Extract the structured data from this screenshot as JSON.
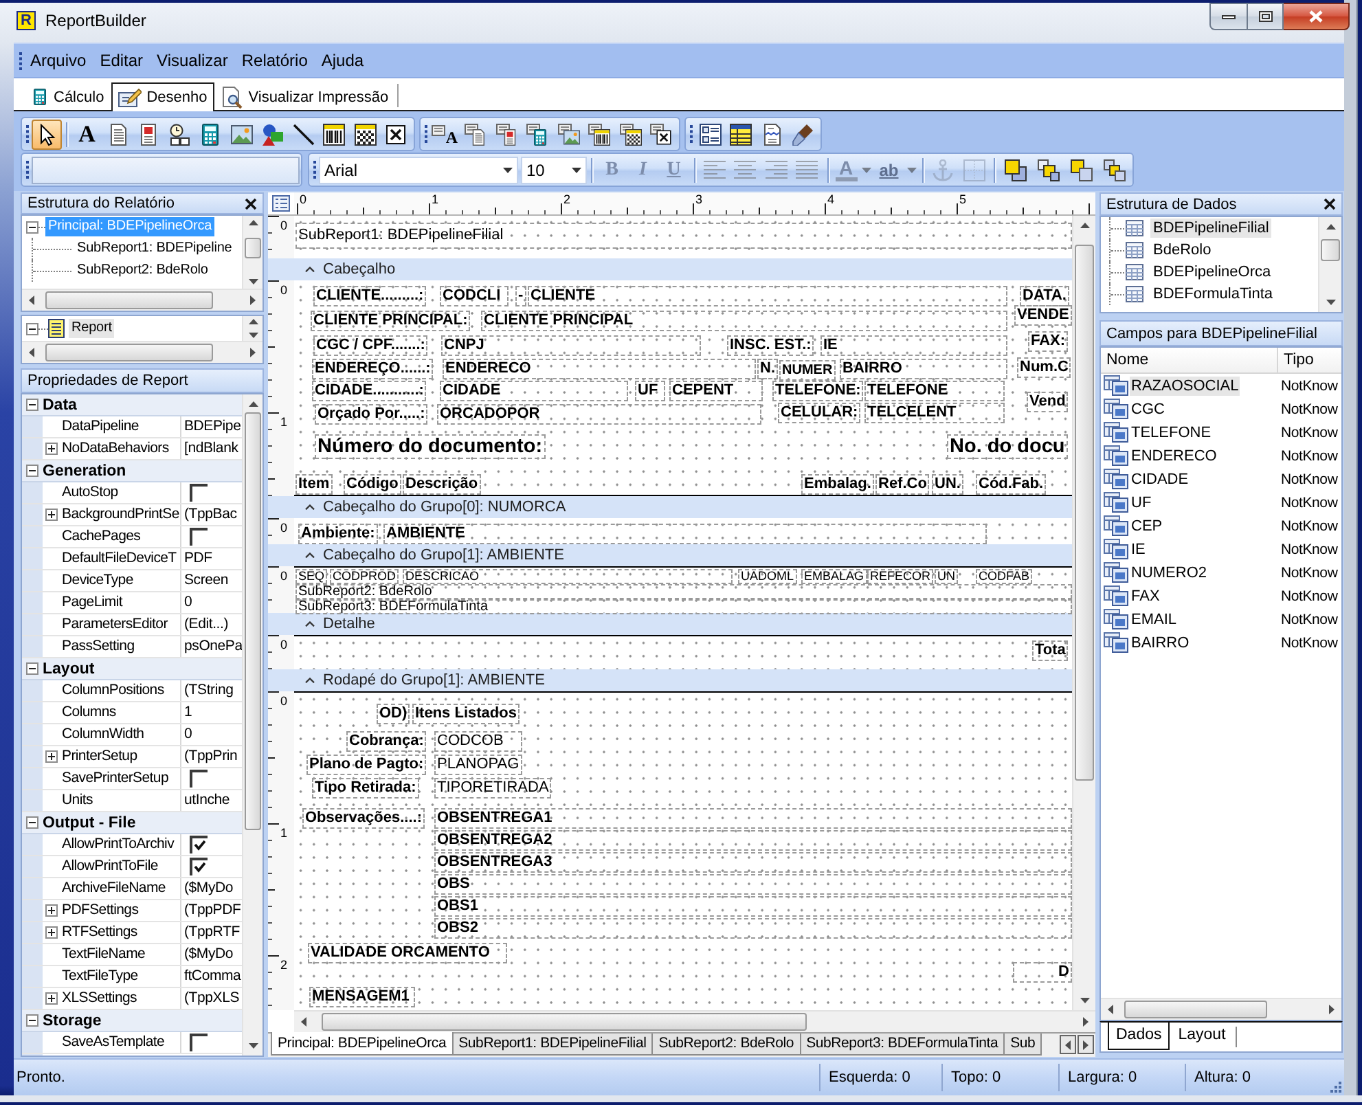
{
  "window": {
    "title": "ReportBuilder",
    "logo_letter": "R"
  },
  "menu": [
    "Arquivo",
    "Editar",
    "Visualizar",
    "Relatório",
    "Ajuda"
  ],
  "view_tabs": [
    {
      "kind": "calculator",
      "label": "Cálculo",
      "selected": false
    },
    {
      "kind": "design",
      "label": "Desenho",
      "selected": true
    },
    {
      "kind": "preview",
      "label": "Visualizar Impressão",
      "selected": false
    }
  ],
  "toolbars": {
    "components": [
      {
        "kind": "pointer",
        "selected": true
      },
      {
        "kind": "label",
        "glyph": "A",
        "selected": false
      },
      {
        "kind": "memo",
        "selected": false
      },
      {
        "kind": "richtext",
        "selected": false
      },
      {
        "kind": "sysvar",
        "selected": false
      },
      {
        "kind": "calc",
        "selected": false
      },
      {
        "kind": "image",
        "selected": false
      },
      {
        "kind": "shape",
        "selected": false
      },
      {
        "kind": "line",
        "selected": false
      },
      {
        "kind": "barcode",
        "selected": false
      },
      {
        "kind": "matrix",
        "selected": false
      },
      {
        "kind": "checkbox",
        "selected": false
      }
    ],
    "data_components": [
      {
        "kind": "dbtext",
        "glyph": "A",
        "selected": false
      },
      {
        "kind": "dbmemo",
        "selected": false
      },
      {
        "kind": "dbrichtext",
        "selected": false
      },
      {
        "kind": "dbcalc",
        "selected": false
      },
      {
        "kind": "dbimage",
        "selected": false
      },
      {
        "kind": "dbbarcode",
        "selected": false
      },
      {
        "kind": "dbmatrix",
        "selected": false
      },
      {
        "kind": "dbcheckbox",
        "selected": false
      }
    ],
    "advanced": [
      {
        "kind": "region",
        "selected": false
      },
      {
        "kind": "subreport",
        "selected": false
      },
      {
        "kind": "pagebreak",
        "selected": false
      },
      {
        "kind": "brush",
        "selected": false
      }
    ],
    "format": {
      "font": "Arial",
      "size": "10",
      "buttons": [
        {
          "kind": "bold",
          "glyph": "B",
          "disabled": true
        },
        {
          "kind": "italic",
          "glyph": "I",
          "disabled": true
        },
        {
          "kind": "underline",
          "glyph": "U",
          "disabled": true
        },
        {
          "kind": "align_left",
          "disabled": true
        },
        {
          "kind": "align_center",
          "disabled": true
        },
        {
          "kind": "align_right",
          "disabled": true
        },
        {
          "kind": "justify",
          "disabled": true
        },
        {
          "kind": "font_color",
          "glyph": "A",
          "disabled": true
        },
        {
          "kind": "highlight",
          "glyph": "ab",
          "disabled": true
        },
        {
          "kind": "anchor",
          "disabled": true
        },
        {
          "kind": "border",
          "disabled": true
        },
        {
          "kind": "bring_front",
          "disabled": false
        },
        {
          "kind": "send_back",
          "disabled": false
        },
        {
          "kind": "bring_forward",
          "disabled": false
        },
        {
          "kind": "send_backward",
          "disabled": false
        }
      ]
    }
  },
  "report_panel": {
    "title": "Estrutura do Relatório",
    "tree": [
      {
        "label": "Principal: BDEPipelineOrca",
        "selected": true,
        "expanded": true,
        "children": [
          {
            "label": "SubReport1: BDEPipeline",
            "selected": false
          },
          {
            "label": "SubReport2: BdeRolo",
            "selected": false
          }
        ]
      }
    ],
    "components": [
      {
        "label": "Report",
        "selected": true,
        "expanded": true
      }
    ]
  },
  "properties": {
    "title": "Propriedades de Report",
    "categories": [
      {
        "name": "Data",
        "expanded": true,
        "rows": [
          {
            "kind": "text",
            "name": "DataPipeline",
            "value": "BDEPipe",
            "expandable": false
          },
          {
            "kind": "text",
            "name": "NoDataBehaviors",
            "value": "[ndBlank",
            "expandable": true
          }
        ]
      },
      {
        "name": "Generation",
        "expanded": true,
        "rows": [
          {
            "kind": "check",
            "name": "AutoStop",
            "checked": false,
            "expandable": false
          },
          {
            "kind": "text",
            "name": "BackgroundPrintSe",
            "value": "(TppBac",
            "expandable": true
          },
          {
            "kind": "check",
            "name": "CachePages",
            "checked": false,
            "expandable": false
          },
          {
            "kind": "text",
            "name": "DefaultFileDeviceT",
            "value": "PDF",
            "expandable": false
          },
          {
            "kind": "text",
            "name": "DeviceType",
            "value": "Screen",
            "expandable": false
          },
          {
            "kind": "text",
            "name": "PageLimit",
            "value": "0",
            "expandable": false
          },
          {
            "kind": "text",
            "name": "ParametersEditor",
            "value": "(Edit...)",
            "expandable": false
          },
          {
            "kind": "text",
            "name": "PassSetting",
            "value": "psOnePa",
            "expandable": false
          }
        ]
      },
      {
        "name": "Layout",
        "expanded": true,
        "rows": [
          {
            "kind": "text",
            "name": "ColumnPositions",
            "value": "(TString",
            "expandable": false
          },
          {
            "kind": "text",
            "name": "Columns",
            "value": "1",
            "expandable": false
          },
          {
            "kind": "text",
            "name": "ColumnWidth",
            "value": "0",
            "expandable": false
          },
          {
            "kind": "text",
            "name": "PrinterSetup",
            "value": "(TppPrin",
            "expandable": true
          },
          {
            "kind": "check",
            "name": "SavePrinterSetup",
            "checked": false,
            "expandable": false
          },
          {
            "kind": "text",
            "name": "Units",
            "value": "utInche",
            "expandable": false
          }
        ]
      },
      {
        "name": "Output - File",
        "expanded": true,
        "rows": [
          {
            "kind": "check",
            "name": "AllowPrintToArchiv",
            "checked": true,
            "expandable": false
          },
          {
            "kind": "check",
            "name": "AllowPrintToFile",
            "checked": true,
            "expandable": false
          },
          {
            "kind": "text",
            "name": "ArchiveFileName",
            "value": "($MyDo",
            "expandable": false
          },
          {
            "kind": "text",
            "name": "PDFSettings",
            "value": "(TppPDF",
            "expandable": true
          },
          {
            "kind": "text",
            "name": "RTFSettings",
            "value": "(TppRTF",
            "expandable": true
          },
          {
            "kind": "text",
            "name": "TextFileName",
            "value": "($MyDo",
            "expandable": false
          },
          {
            "kind": "text",
            "name": "TextFileType",
            "value": "ftComma",
            "expandable": false
          },
          {
            "kind": "text",
            "name": "XLSSettings",
            "value": "(TppXLS",
            "expandable": true
          }
        ]
      },
      {
        "name": "Storage",
        "expanded": true,
        "rows": [
          {
            "kind": "check",
            "name": "SaveAsTemplate",
            "checked": false,
            "expandable": false
          }
        ]
      }
    ]
  },
  "designer": {
    "ruler": [
      "0",
      "1",
      "2",
      "3",
      "4",
      "5"
    ],
    "bands": [
      {
        "ruler": [
          "0"
        ],
        "items": [
          "SubReport1: BDEPipelineFilial"
        ],
        "caption": "Cabeçalho"
      },
      {
        "ruler": [
          "0",
          "1"
        ],
        "items": [
          "CLIENTE.........:",
          "CODCLI",
          "-",
          "CLIENTE",
          "DATA.",
          "CLIENTE PRINCIPAL:",
          "CLIENTE PRINCIPAL",
          "VENDE",
          "CGC / CPF.......:",
          "CNPJ",
          "INSC. EST.:",
          "IE",
          "FAX:",
          "ENDEREÇO......:",
          "ENDERECO",
          "N.",
          "NUMER",
          "BAIRRO",
          "Num.C",
          "CIDADE...........:",
          "CIDADE",
          "UF",
          "CEPENT",
          "TELEFONE:",
          "TELEFONE",
          "Vend",
          "Orçado Por.....:",
          "ORCADOPOR",
          "CELULAR:",
          "TELCELENT",
          "Número do documento:",
          "No. do docu",
          "Item",
          "Código",
          "Descrição",
          "Embalag.",
          "Ref.Co",
          "UN.",
          "Cód.Fab."
        ],
        "caption": "Cabeçalho do Grupo[0]: NUMORCA"
      },
      {
        "ruler": [
          "0"
        ],
        "items": [
          "Ambiente:",
          "AMBIENTE"
        ],
        "caption": "Cabeçalho do Grupo[1]: AMBIENTE"
      },
      {
        "ruler": [
          "0"
        ],
        "items": [
          "SEQ",
          "CODPROD",
          "DESCRICAO",
          "UADOML",
          "EMBALAG",
          "REFECOR",
          "UN",
          "CODFAB",
          "SubReport2: BdeRolo",
          "SubReport3: BDEFormulaTinta"
        ],
        "caption": "Detalhe"
      },
      {
        "ruler": [
          "0"
        ],
        "items": [
          "Tota"
        ],
        "caption": "Rodapé do Grupo[1]: AMBIENTE"
      },
      {
        "ruler": [
          "0",
          "1",
          "2"
        ],
        "items": [
          "OD)",
          "Itens Listados",
          "Cobrança:",
          "CODCOB",
          "Plano de Pagto:",
          "PLANOPAG",
          "Tipo Retirada:",
          "TIPORETIRADA",
          "Observações....:",
          "OBSENTREGA1",
          "OBSENTREGA2",
          "OBSENTREGA3",
          "OBS",
          "OBS1",
          "OBS2",
          "VALIDADE ORCAMENTO",
          "D",
          "MENSAGEM1"
        ]
      }
    ],
    "tabs": [
      {
        "label": "Principal: BDEPipelineOrca",
        "selected": true
      },
      {
        "label": "SubReport1: BDEPipelineFilial",
        "selected": false
      },
      {
        "label": "SubReport2: BdeRolo",
        "selected": false
      },
      {
        "label": "SubReport3: BDEFormulaTinta",
        "selected": false
      },
      {
        "label": "Sub",
        "selected": false
      }
    ]
  },
  "data_panel": {
    "title": "Estrutura de Dados",
    "pipelines": [
      {
        "label": "BDEPipelineFilial",
        "selected": true
      },
      {
        "label": "BdeRolo",
        "selected": false
      },
      {
        "label": "BDEPipelineOrca",
        "selected": false
      },
      {
        "label": "BDEFormulaTinta",
        "selected": false
      }
    ],
    "fields_title": "Campos para BDEPipelineFilial",
    "columns": [
      "Nome",
      "Tipo"
    ],
    "fields": [
      {
        "name": "RAZAOSOCIAL",
        "type": "NotKnow",
        "selected": true
      },
      {
        "name": "CGC",
        "type": "NotKnow",
        "selected": false
      },
      {
        "name": "TELEFONE",
        "type": "NotKnow",
        "selected": false
      },
      {
        "name": "ENDERECO",
        "type": "NotKnow",
        "selected": false
      },
      {
        "name": "CIDADE",
        "type": "NotKnow",
        "selected": false
      },
      {
        "name": "UF",
        "type": "NotKnow",
        "selected": false
      },
      {
        "name": "CEP",
        "type": "NotKnow",
        "selected": false
      },
      {
        "name": "IE",
        "type": "NotKnow",
        "selected": false
      },
      {
        "name": "NUMERO2",
        "type": "NotKnow",
        "selected": false
      },
      {
        "name": "FAX",
        "type": "NotKnow",
        "selected": false
      },
      {
        "name": "EMAIL",
        "type": "NotKnow",
        "selected": false
      },
      {
        "name": "BAIRRO",
        "type": "NotKnow",
        "selected": false
      }
    ],
    "tabs": [
      {
        "label": "Dados",
        "selected": true
      },
      {
        "label": "Layout",
        "selected": false
      }
    ]
  },
  "status_bar": {
    "message": "Pronto.",
    "panels": [
      "Esquerda: 0",
      "Topo: 0",
      "Largura: 0",
      "Altura: 0"
    ]
  }
}
